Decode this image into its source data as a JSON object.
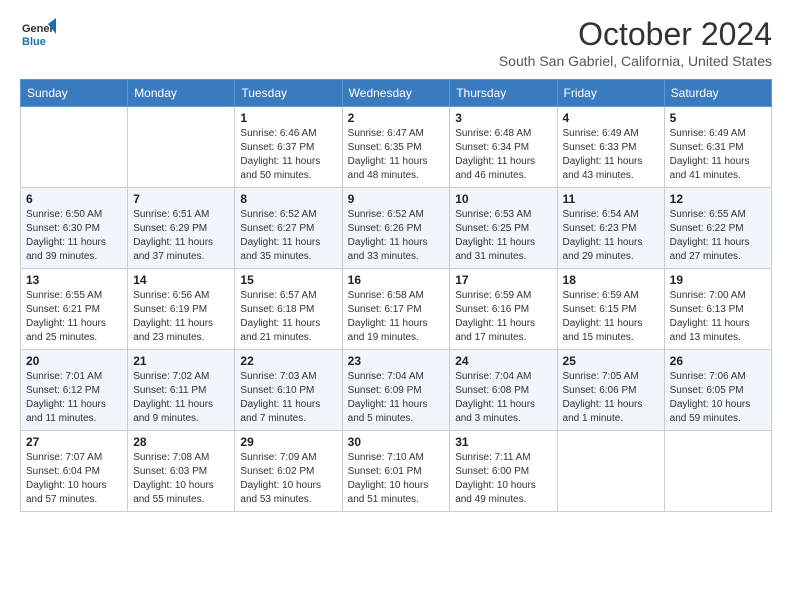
{
  "logo": {
    "line1": "General",
    "line2": "Blue"
  },
  "header": {
    "month": "October 2024",
    "location": "South San Gabriel, California, United States"
  },
  "weekdays": [
    "Sunday",
    "Monday",
    "Tuesday",
    "Wednesday",
    "Thursday",
    "Friday",
    "Saturday"
  ],
  "weeks": [
    [
      {
        "day": "",
        "info": ""
      },
      {
        "day": "",
        "info": ""
      },
      {
        "day": "1",
        "info": "Sunrise: 6:46 AM\nSunset: 6:37 PM\nDaylight: 11 hours and 50 minutes."
      },
      {
        "day": "2",
        "info": "Sunrise: 6:47 AM\nSunset: 6:35 PM\nDaylight: 11 hours and 48 minutes."
      },
      {
        "day": "3",
        "info": "Sunrise: 6:48 AM\nSunset: 6:34 PM\nDaylight: 11 hours and 46 minutes."
      },
      {
        "day": "4",
        "info": "Sunrise: 6:49 AM\nSunset: 6:33 PM\nDaylight: 11 hours and 43 minutes."
      },
      {
        "day": "5",
        "info": "Sunrise: 6:49 AM\nSunset: 6:31 PM\nDaylight: 11 hours and 41 minutes."
      }
    ],
    [
      {
        "day": "6",
        "info": "Sunrise: 6:50 AM\nSunset: 6:30 PM\nDaylight: 11 hours and 39 minutes."
      },
      {
        "day": "7",
        "info": "Sunrise: 6:51 AM\nSunset: 6:29 PM\nDaylight: 11 hours and 37 minutes."
      },
      {
        "day": "8",
        "info": "Sunrise: 6:52 AM\nSunset: 6:27 PM\nDaylight: 11 hours and 35 minutes."
      },
      {
        "day": "9",
        "info": "Sunrise: 6:52 AM\nSunset: 6:26 PM\nDaylight: 11 hours and 33 minutes."
      },
      {
        "day": "10",
        "info": "Sunrise: 6:53 AM\nSunset: 6:25 PM\nDaylight: 11 hours and 31 minutes."
      },
      {
        "day": "11",
        "info": "Sunrise: 6:54 AM\nSunset: 6:23 PM\nDaylight: 11 hours and 29 minutes."
      },
      {
        "day": "12",
        "info": "Sunrise: 6:55 AM\nSunset: 6:22 PM\nDaylight: 11 hours and 27 minutes."
      }
    ],
    [
      {
        "day": "13",
        "info": "Sunrise: 6:55 AM\nSunset: 6:21 PM\nDaylight: 11 hours and 25 minutes."
      },
      {
        "day": "14",
        "info": "Sunrise: 6:56 AM\nSunset: 6:19 PM\nDaylight: 11 hours and 23 minutes."
      },
      {
        "day": "15",
        "info": "Sunrise: 6:57 AM\nSunset: 6:18 PM\nDaylight: 11 hours and 21 minutes."
      },
      {
        "day": "16",
        "info": "Sunrise: 6:58 AM\nSunset: 6:17 PM\nDaylight: 11 hours and 19 minutes."
      },
      {
        "day": "17",
        "info": "Sunrise: 6:59 AM\nSunset: 6:16 PM\nDaylight: 11 hours and 17 minutes."
      },
      {
        "day": "18",
        "info": "Sunrise: 6:59 AM\nSunset: 6:15 PM\nDaylight: 11 hours and 15 minutes."
      },
      {
        "day": "19",
        "info": "Sunrise: 7:00 AM\nSunset: 6:13 PM\nDaylight: 11 hours and 13 minutes."
      }
    ],
    [
      {
        "day": "20",
        "info": "Sunrise: 7:01 AM\nSunset: 6:12 PM\nDaylight: 11 hours and 11 minutes."
      },
      {
        "day": "21",
        "info": "Sunrise: 7:02 AM\nSunset: 6:11 PM\nDaylight: 11 hours and 9 minutes."
      },
      {
        "day": "22",
        "info": "Sunrise: 7:03 AM\nSunset: 6:10 PM\nDaylight: 11 hours and 7 minutes."
      },
      {
        "day": "23",
        "info": "Sunrise: 7:04 AM\nSunset: 6:09 PM\nDaylight: 11 hours and 5 minutes."
      },
      {
        "day": "24",
        "info": "Sunrise: 7:04 AM\nSunset: 6:08 PM\nDaylight: 11 hours and 3 minutes."
      },
      {
        "day": "25",
        "info": "Sunrise: 7:05 AM\nSunset: 6:06 PM\nDaylight: 11 hours and 1 minute."
      },
      {
        "day": "26",
        "info": "Sunrise: 7:06 AM\nSunset: 6:05 PM\nDaylight: 10 hours and 59 minutes."
      }
    ],
    [
      {
        "day": "27",
        "info": "Sunrise: 7:07 AM\nSunset: 6:04 PM\nDaylight: 10 hours and 57 minutes."
      },
      {
        "day": "28",
        "info": "Sunrise: 7:08 AM\nSunset: 6:03 PM\nDaylight: 10 hours and 55 minutes."
      },
      {
        "day": "29",
        "info": "Sunrise: 7:09 AM\nSunset: 6:02 PM\nDaylight: 10 hours and 53 minutes."
      },
      {
        "day": "30",
        "info": "Sunrise: 7:10 AM\nSunset: 6:01 PM\nDaylight: 10 hours and 51 minutes."
      },
      {
        "day": "31",
        "info": "Sunrise: 7:11 AM\nSunset: 6:00 PM\nDaylight: 10 hours and 49 minutes."
      },
      {
        "day": "",
        "info": ""
      },
      {
        "day": "",
        "info": ""
      }
    ]
  ]
}
